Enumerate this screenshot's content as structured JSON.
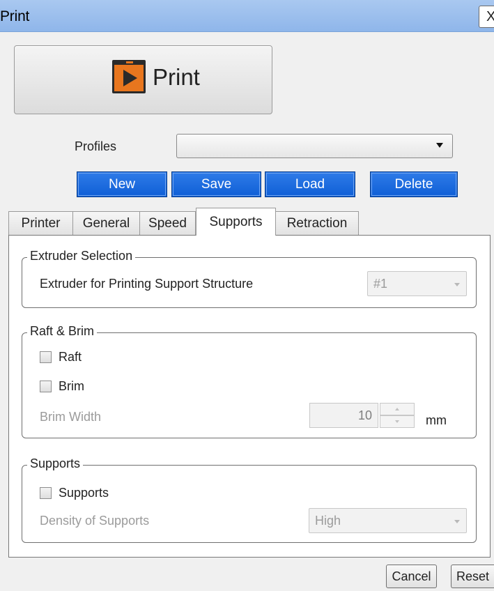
{
  "window": {
    "title": "Print",
    "close_label": "X"
  },
  "big_button": {
    "label": "Print",
    "icon": "play-icon"
  },
  "profiles": {
    "label": "Profiles",
    "selected": "",
    "buttons": {
      "new": "New",
      "save": "Save",
      "load": "Load",
      "delete": "Delete"
    }
  },
  "tabs": [
    {
      "label": "Printer",
      "active": false
    },
    {
      "label": "General",
      "active": false
    },
    {
      "label": "Speed",
      "active": false
    },
    {
      "label": "Supports",
      "active": true
    },
    {
      "label": "Retraction",
      "active": false
    }
  ],
  "groups": {
    "extruder": {
      "title": "Extruder Selection",
      "field_label": "Extruder for Printing Support Structure",
      "value": "#1"
    },
    "raft_brim": {
      "title": "Raft & Brim",
      "raft_label": "Raft",
      "raft_checked": false,
      "brim_label": "Brim",
      "brim_checked": false,
      "brim_width_label": "Brim Width",
      "brim_width_value": "10",
      "brim_width_unit": "mm"
    },
    "supports": {
      "title": "Supports",
      "supports_label": "Supports",
      "supports_checked": false,
      "density_label": "Density of Supports",
      "density_value": "High"
    }
  },
  "footer": {
    "cancel": "Cancel",
    "reset": "Reset"
  },
  "colors": {
    "accent_blue": "#1565d8",
    "titlebar": "#9dbfee",
    "icon_orange": "#e8761e"
  }
}
